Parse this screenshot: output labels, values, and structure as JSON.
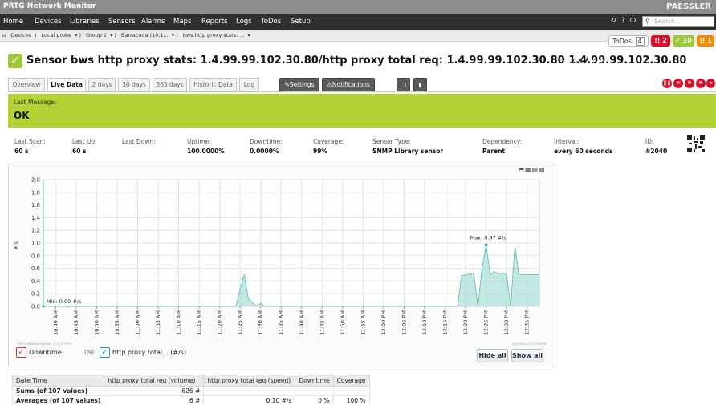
{
  "app": {
    "title": "PRTG Network Monitor",
    "brand": "PAESSLER"
  },
  "menu": [
    "Home",
    "Devices",
    "Libraries",
    "Sensors",
    "Alarms",
    "Maps",
    "Reports",
    "Logs",
    "ToDos",
    "Setup"
  ],
  "search": {
    "placeholder": "Search..."
  },
  "breadcrumb": [
    "Devices",
    "Local probe",
    "Group 2",
    "Barracuda (10.1...",
    "bws http proxy stats: ..."
  ],
  "todos": {
    "label": "ToDos",
    "count": "4"
  },
  "alarm_badges": [
    {
      "icon": "!!",
      "count": "2",
      "color": "#d9102b"
    },
    {
      "icon": "✓",
      "count": "10",
      "color": "#9cc83a"
    },
    {
      "icon": "!!",
      "count": "1",
      "color": "#f08c00"
    }
  ],
  "sensor": {
    "title": "Sensor bws http proxy stats: 1.4.99.99.102.30.80/http proxy total req: 1.4.99.99.102.30.80 1.4.99.99.102.30.80",
    "stars_on": "★★★",
    "stars_off": "★★"
  },
  "tabs": [
    "Overview",
    "Live Data",
    "2 days",
    "30 days",
    "365 days",
    "Historic Data",
    "Log"
  ],
  "action_tabs": {
    "settings": "Settings",
    "notifications": "Notifications"
  },
  "status": {
    "label": "Last Message:",
    "value": "OK"
  },
  "info": [
    {
      "k": "Last Scan:",
      "v": "60 s"
    },
    {
      "k": "Last Up:",
      "v": "60 s"
    },
    {
      "k": "Last Down:",
      "v": ""
    },
    {
      "k": "Uptime:",
      "v": "100.0000%"
    },
    {
      "k": "Downtime:",
      "v": "0.0000%"
    },
    {
      "k": "Coverage:",
      "v": "99%"
    },
    {
      "k": "Sensor Type:",
      "v": "SNMP Library sensor"
    },
    {
      "k": "Dependency:",
      "v": "Parent"
    },
    {
      "k": "Interval:",
      "v": "every 60 seconds"
    },
    {
      "k": "ID:",
      "v": "#2040"
    }
  ],
  "chart_data": {
    "type": "area",
    "ylabel": "#/s",
    "ylim": [
      0,
      2.0
    ],
    "yticks": [
      "0.0",
      "0.2",
      "0.4",
      "0.6",
      "0.8",
      "1.0",
      "1.2",
      "1.4",
      "1.6",
      "1.8",
      "2.0"
    ],
    "xticks": [
      "10:40 AM",
      "10:45 AM",
      "10:50 AM",
      "10:55 AM",
      "11:00 AM",
      "11:05 AM",
      "11:10 AM",
      "11:15 AM",
      "11:20 AM",
      "11:25 AM",
      "11:30 AM",
      "11:35 AM",
      "11:40 AM",
      "11:45 AM",
      "11:50 AM",
      "11:55 AM",
      "12:00 PM",
      "12:05 PM",
      "12:10 PM",
      "12:15 PM",
      "12:20 PM",
      "12:25 PM",
      "12:30 PM",
      "12:35 PM"
    ],
    "x_start": "10:37 AM",
    "x_end": "12:38 PM",
    "series": [
      {
        "name": "http proxy total... (#/s)",
        "color": "#8fd6cc",
        "x": [
          "10:37 AM",
          "10:38 AM",
          "11:24 AM",
          "11:25 AM",
          "11:26 AM",
          "11:27 AM",
          "11:29 AM",
          "11:30 AM",
          "11:31 AM",
          "12:18 PM",
          "12:19 PM",
          "12:20 PM",
          "12:22 PM",
          "12:23 PM",
          "12:24 PM",
          "12:25 PM",
          "12:26 PM",
          "12:27 PM",
          "12:28 PM",
          "12:30 PM",
          "12:31 PM",
          "12:32 PM",
          "12:33 PM",
          "12:35 PM",
          "12:38 PM"
        ],
        "y": [
          0.0,
          0.0,
          0.0,
          0.28,
          0.5,
          0.12,
          0.0,
          0.05,
          0.0,
          0.0,
          0.48,
          0.5,
          0.52,
          0.0,
          0.6,
          0.97,
          0.5,
          0.55,
          0.52,
          0.52,
          0.0,
          0.96,
          0.5,
          0.5,
          0.5
        ]
      }
    ],
    "annotations": {
      "max": "Max: 0.97 #/s",
      "min": "Min: 0.00 #/s"
    },
    "footer_left": "PRTG Network Monitor 13.4.7.3705",
    "footer_right": "2/6/2014 12:37:39 PM"
  },
  "legend": {
    "downtime": "Downtime",
    "downtime_unit": "(%)",
    "series": "http proxy total... (#/s)",
    "hide_all": "Hide all",
    "show_all": "Show all"
  },
  "table": {
    "headers": [
      "Date Time",
      "http proxy total req (volume)",
      "http proxy total req (speed)",
      "Downtime",
      "Coverage"
    ],
    "rows": [
      [
        "Sums (of 107 values)",
        "626 #",
        "",
        "",
        ""
      ],
      [
        "Averages (of 107 values)",
        "6 #",
        "0.10 #/s",
        "0 %",
        "100 %"
      ]
    ]
  }
}
